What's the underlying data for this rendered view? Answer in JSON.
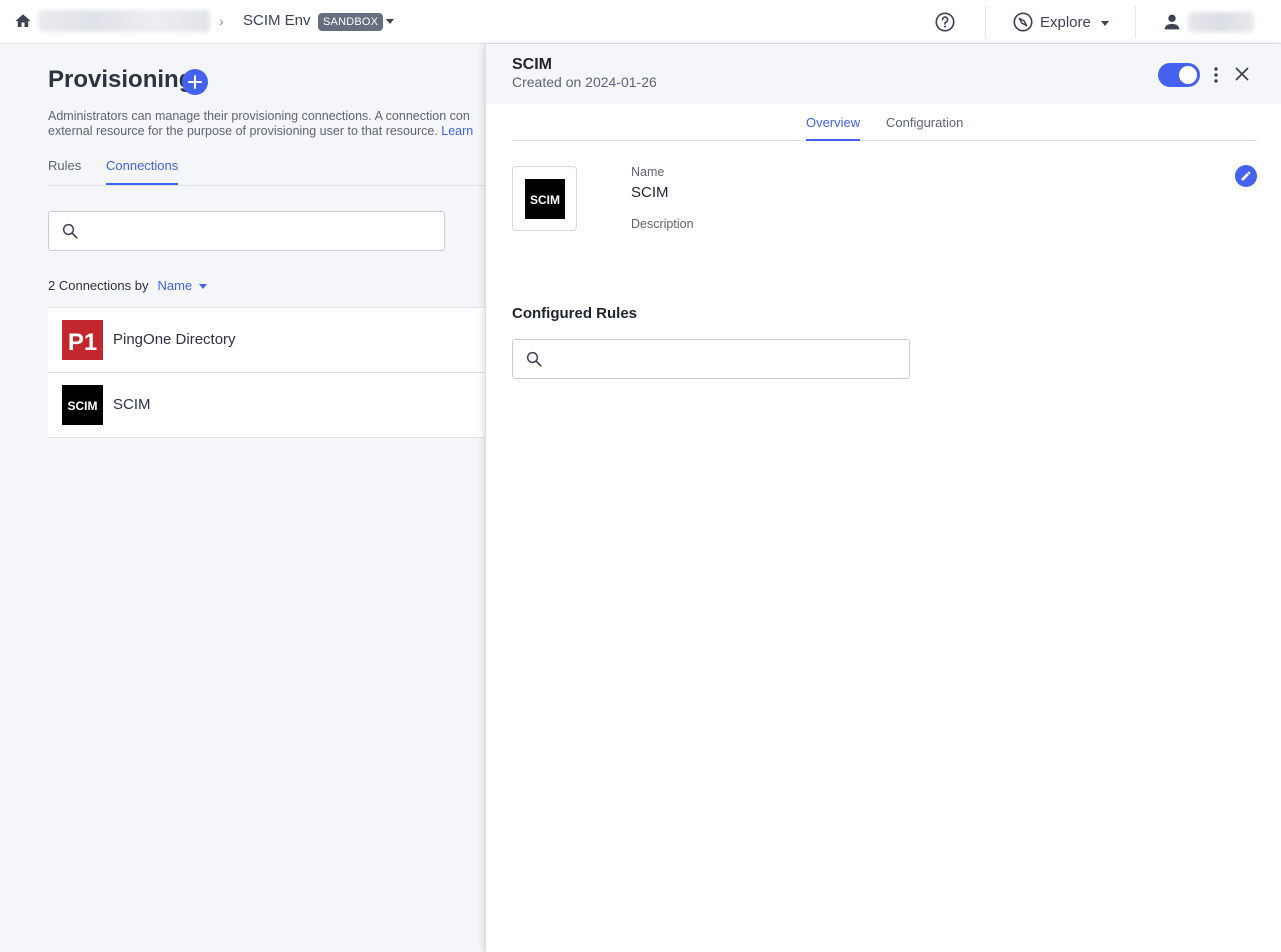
{
  "topbar": {
    "environment_name": "SCIM Env",
    "environment_badge": "SANDBOX",
    "explore_label": "Explore",
    "breadcrumb_separator": "›"
  },
  "page": {
    "title": "Provisioning",
    "description_line1": "Administrators can manage their provisioning connections. A connection con",
    "description_line2": "external resource for the purpose of provisioning user to that resource.",
    "description_link": "Learn",
    "tabs": [
      {
        "label": "Rules",
        "active": false
      },
      {
        "label": "Connections",
        "active": true
      }
    ],
    "search_placeholder": "",
    "count_text": "2 Connections by",
    "sort_label": "Name",
    "connections": [
      {
        "name": "PingOne Directory",
        "logo": "p1-logo"
      },
      {
        "name": "SCIM",
        "logo": "scim-logo"
      }
    ]
  },
  "panel": {
    "title": "SCIM",
    "subtitle": "Created on 2024-01-26",
    "enabled": true,
    "tabs": [
      {
        "label": "Overview",
        "active": true
      },
      {
        "label": "Configuration",
        "active": false
      }
    ],
    "name_label": "Name",
    "name_value": "SCIM",
    "description_label": "Description",
    "configured_rules_title": "Configured Rules",
    "rules_search_placeholder": ""
  },
  "logos": {
    "p1_text": "P1",
    "scim_text": "SCIM"
  },
  "colors": {
    "accent": "#4462ed",
    "p1_red": "#c2272d",
    "scim_black": "#000000",
    "badge_gray": "#676e7e"
  },
  "icons": [
    "home-icon",
    "help-icon",
    "compass-icon",
    "user-icon",
    "search-icon",
    "plus-icon",
    "kebab-icon",
    "close-icon",
    "pencil-icon"
  ]
}
